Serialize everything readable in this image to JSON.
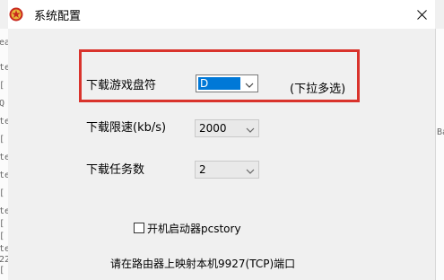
{
  "window": {
    "title": "系统配置"
  },
  "form": {
    "drive_label": "下载游戏盘符",
    "drive_value": "D",
    "drive_hint": "(下拉多选)",
    "speed_label": "下载限速(kb/s)",
    "speed_value": "2000",
    "tasks_label": "下载任务数",
    "tasks_value": "2",
    "autostart_label": "开机启动器pcstory",
    "autostart_checked": false,
    "port_note": "请在路由器上映射本机9927(TCP)端口"
  },
  "background_left_fragments": [
    "ea",
    "te",
    "[",
    "Q",
    "te",
    "[",
    "te",
    "te",
    "[",
    "te",
    "[",
    "[",
    "te",
    "22",
    "[",
    "te"
  ],
  "background_right_fragments": [
    "",
    "",
    "",
    "",
    "",
    "",
    "",
    "",
    "Ba",
    "",
    "",
    "",
    "",
    "",
    "",
    ""
  ],
  "colors": {
    "highlight": "#d9332c",
    "selection": "#0078d7"
  }
}
